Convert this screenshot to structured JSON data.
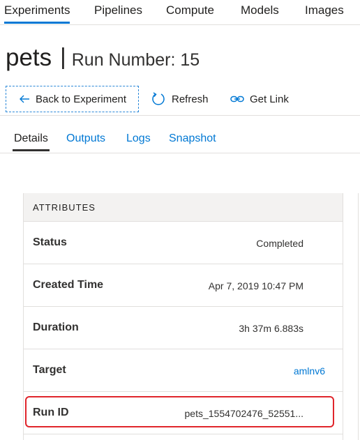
{
  "topnav": {
    "items": [
      {
        "label": "Experiments",
        "active": true
      },
      {
        "label": "Pipelines",
        "active": false
      },
      {
        "label": "Compute",
        "active": false
      },
      {
        "label": "Models",
        "active": false
      },
      {
        "label": "Images",
        "active": false
      }
    ]
  },
  "header": {
    "experiment_name": "pets",
    "separator": "|",
    "run_label": "Run Number: 15"
  },
  "commands": {
    "back": {
      "label": "Back to Experiment",
      "icon": "arrow-left-icon"
    },
    "refresh": {
      "label": "Refresh",
      "icon": "refresh-icon"
    },
    "get_link": {
      "label": "Get Link",
      "icon": "link-icon"
    }
  },
  "tabs": [
    {
      "label": "Details",
      "active": true
    },
    {
      "label": "Outputs",
      "active": false
    },
    {
      "label": "Logs",
      "active": false
    },
    {
      "label": "Snapshot",
      "active": false
    }
  ],
  "attributes": {
    "heading": "ATTRIBUTES",
    "rows": [
      {
        "label": "Status",
        "value": "Completed"
      },
      {
        "label": "Created Time",
        "value": "Apr 7, 2019 10:47 PM"
      },
      {
        "label": "Duration",
        "value": "3h 37m 6.883s"
      },
      {
        "label": "Target",
        "value": "amlnv6"
      },
      {
        "label": "Run ID",
        "value": "pets_1554702476_52551..."
      }
    ]
  },
  "colors": {
    "accent": "#0078d4",
    "highlight": "#e0252b"
  }
}
